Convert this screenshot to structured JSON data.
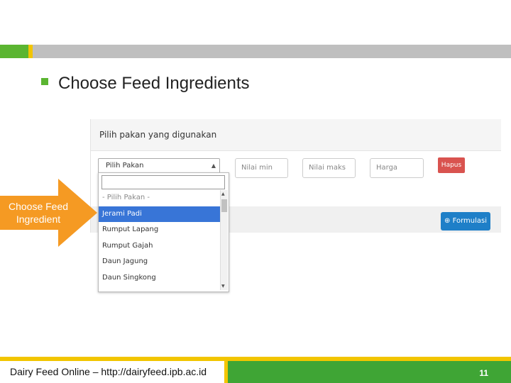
{
  "slide": {
    "heading": "Choose Feed Ingredients",
    "callout": "Choose Feed Ingredient",
    "footer_text": "Dairy Feed Online – http://dairyfeed.ipb.ac.id",
    "page_number": "11",
    "colors": {
      "green": "#5bb531",
      "yellow": "#f2c500",
      "orange": "#f59a23",
      "footer_green": "#3fa535"
    }
  },
  "app": {
    "panel_title": "Pilih pakan yang digunakan",
    "select_value": "Pilih Pakan",
    "inputs": {
      "min_placeholder": "Nilai min",
      "max_placeholder": "Nilai maks",
      "price_placeholder": "Harga"
    },
    "delete_button": "Hapus",
    "formulate_button": "Formulasi",
    "formulate_icon": "plus-circle-icon",
    "dropdown_items": [
      {
        "label": "- Pilih Pakan -"
      },
      {
        "label": "Jerami Padi"
      },
      {
        "label": "Rumput Lapang"
      },
      {
        "label": "Rumput Gajah"
      },
      {
        "label": "Daun Jagung"
      },
      {
        "label": "Daun Singkong"
      }
    ]
  }
}
